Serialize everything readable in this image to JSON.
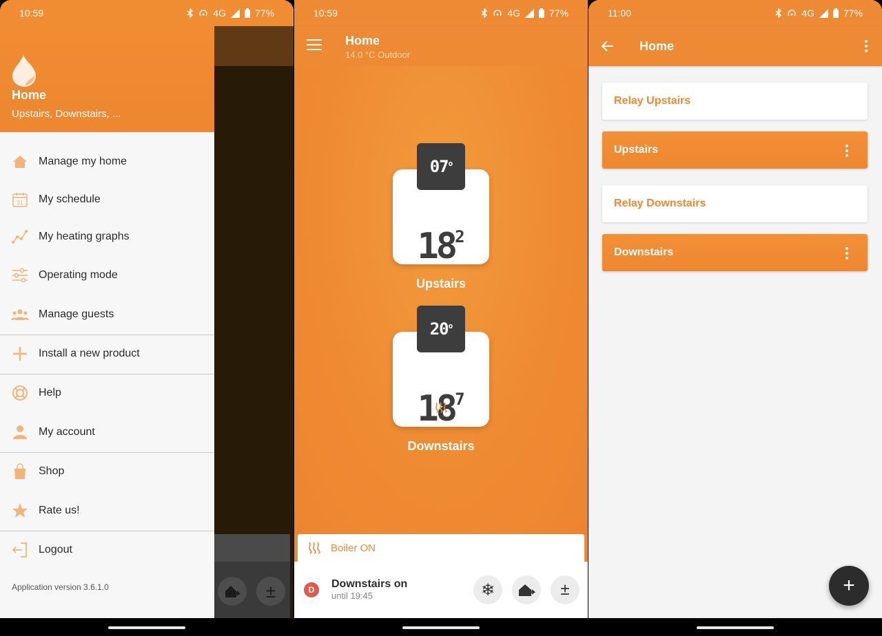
{
  "screen1": {
    "status": {
      "time": "10:59",
      "network": "4G",
      "battery": "77%"
    },
    "drawer": {
      "title": "Home",
      "subtitle": "Upstairs, Downstairs, ...",
      "items": [
        {
          "label": "Manage my home",
          "icon": "home-icon"
        },
        {
          "label": "My schedule",
          "icon": "calendar-icon"
        },
        {
          "label": "My heating graphs",
          "icon": "graph-icon"
        },
        {
          "label": "Operating mode",
          "icon": "sliders-icon"
        },
        {
          "label": "Manage guests",
          "icon": "guests-icon"
        },
        {
          "label": "Install a new product",
          "icon": "plus-icon"
        },
        {
          "label": "Help",
          "icon": "lifebuoy-icon"
        },
        {
          "label": "My account",
          "icon": "person-icon"
        },
        {
          "label": "Shop",
          "icon": "shopping-bag-icon"
        },
        {
          "label": "Rate us!",
          "icon": "star-icon"
        },
        {
          "label": "Logout",
          "icon": "logout-icon"
        }
      ],
      "calendar_day": "31",
      "app_version": "Application version 3.6.1.0"
    }
  },
  "screen2": {
    "status": {
      "time": "10:59",
      "network": "4G",
      "battery": "77%"
    },
    "appbar": {
      "title": "Home",
      "subtitle": "14.0 °C Outdoor"
    },
    "thermostats": [
      {
        "name": "Upstairs",
        "setpoint": "07",
        "temp_main": "18",
        "temp_dec": "2",
        "heating": false
      },
      {
        "name": "Downstairs",
        "setpoint": "20",
        "temp_main": "18",
        "temp_dec": "7",
        "heating": true
      }
    ],
    "degree_mark": "o",
    "boiler_status": "Boiler ON",
    "mode": {
      "badge": "D",
      "title": "Downstairs on",
      "subtitle": "until 19:45"
    },
    "buttons": {
      "frost": "❄",
      "away": "⌂",
      "plusminus": "±"
    }
  },
  "screen3": {
    "status": {
      "time": "11:00",
      "network": "4G",
      "battery": "77%"
    },
    "appbar": {
      "title": "Home"
    },
    "rooms": [
      {
        "label": "Relay Upstairs",
        "style": "white"
      },
      {
        "label": "Upstairs",
        "style": "orange"
      },
      {
        "label": "Relay Downstairs",
        "style": "white"
      },
      {
        "label": "Downstairs",
        "style": "orange"
      }
    ],
    "fab_label": "+"
  },
  "colors": {
    "brand_orange": "#EE8A32",
    "dark": "#3D3D3D",
    "badge_red": "#E05A4C"
  }
}
